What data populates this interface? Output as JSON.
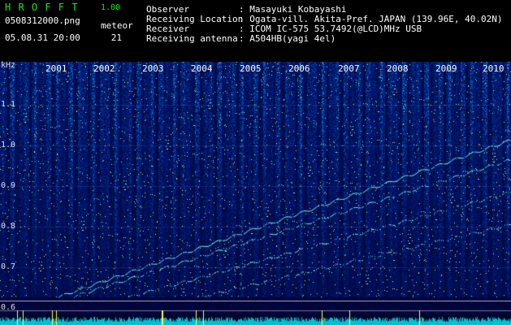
{
  "app": {
    "name": "H R O F F T",
    "version": "1.00",
    "filename": "0508312000.png",
    "datetime": "05.08.31 20:00",
    "meteor_label": "meteor",
    "meteor_count": "21"
  },
  "info": {
    "labels": [
      "Observer",
      "Receiving Location",
      "Receiver",
      "Receiving antenna"
    ],
    "values": [
      ": Masayuki Kobayashi",
      ": Ogata-vill. Akita-Pref. JAPAN (139.96E, 40.02N)",
      ": ICOM IC-575 53.7492(@LCD)MHz USB",
      ": A504HB(yagi 4el)"
    ]
  },
  "chart_data": {
    "type": "heatmap",
    "y_unit": "kHz",
    "y_ticks": [
      "1.1",
      "1.0",
      "0.9",
      "0.8",
      "0.7",
      "0.6"
    ],
    "ylim": [
      0.58,
      1.17
    ],
    "year_labels": [
      "2001",
      "2002",
      "2003",
      "2004",
      "2005",
      "2006",
      "2007",
      "2008",
      "2009",
      "2010"
    ]
  },
  "colors": {
    "background": "#000000",
    "header_green": "#19e619",
    "spectrum_base": "#0a1a6e",
    "trace": "#7fffd4",
    "strip": "#00c0d0"
  }
}
